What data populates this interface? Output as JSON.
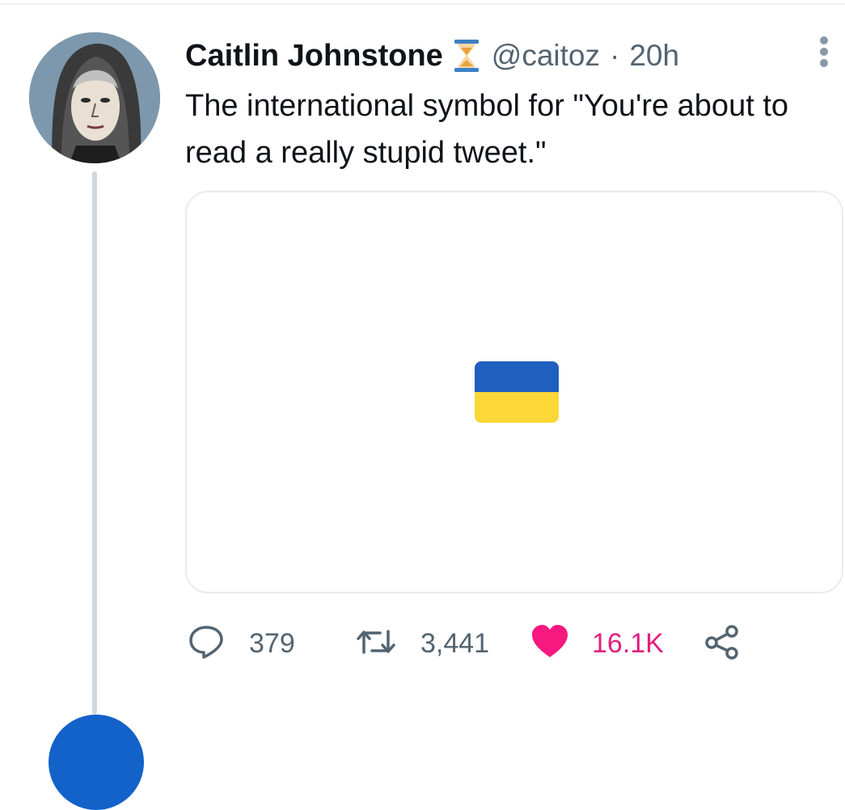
{
  "tweet": {
    "author": {
      "display_name": "Caitlin Johnstone",
      "badge_icon": "hourglass-icon",
      "handle": "@caitoz"
    },
    "separator": "·",
    "timestamp": "20h",
    "text": "The international symbol for \"You're about to read a really stupid tweet.\"",
    "media": {
      "type": "flag-emoji",
      "icon": "ukraine-flag-icon",
      "colors": {
        "top": "#1f5fbf",
        "bottom": "#fbd838"
      }
    },
    "actions": {
      "replies": "379",
      "retweets": "3,441",
      "likes": "16.1K",
      "liked": true
    }
  },
  "colors": {
    "text_primary": "#0f1419",
    "text_secondary": "#536471",
    "like_pink": "#f91880",
    "thread_line": "#cfd9de",
    "next_avatar_blue": "#1262c9"
  }
}
